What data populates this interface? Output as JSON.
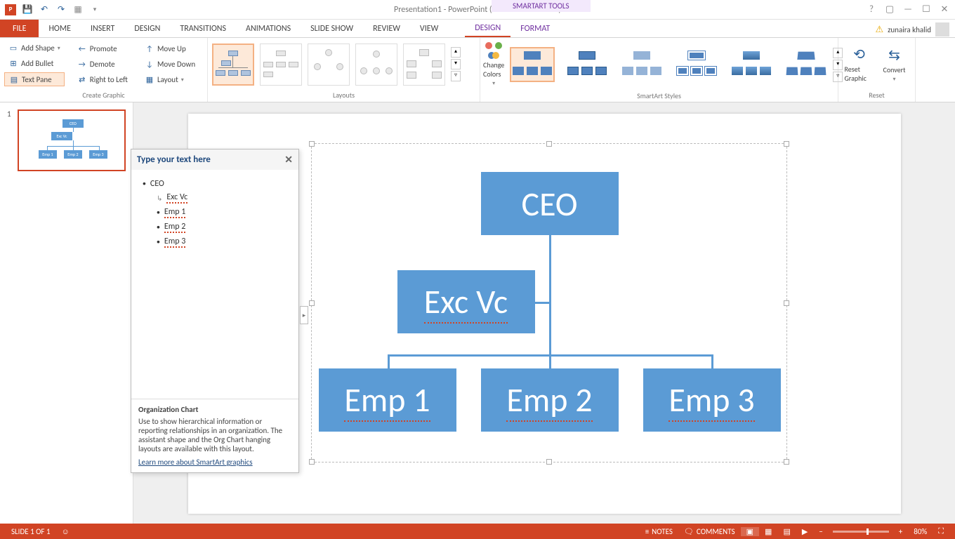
{
  "titlebar": {
    "title": "Presentation1 - PowerPoint (Unlicensed Product)",
    "contextual": "SMARTART TOOLS"
  },
  "user": {
    "name": "zunaira khalid"
  },
  "tabs": {
    "file": "FILE",
    "items": [
      "HOME",
      "INSERT",
      "DESIGN",
      "TRANSITIONS",
      "ANIMATIONS",
      "SLIDE SHOW",
      "REVIEW",
      "VIEW"
    ],
    "context": [
      "DESIGN",
      "FORMAT"
    ],
    "context_active": 0
  },
  "ribbon": {
    "create": {
      "add_shape": "Add Shape",
      "add_bullet": "Add Bullet",
      "text_pane": "Text Pane",
      "promote": "Promote",
      "demote": "Demote",
      "rtl": "Right to Left",
      "move_up": "Move Up",
      "move_down": "Move Down",
      "layout": "Layout",
      "label": "Create Graphic"
    },
    "layouts_label": "Layouts",
    "change_colors": "Change Colors",
    "styles_label": "SmartArt Styles",
    "reset": "Reset Graphic",
    "convert": "Convert",
    "reset_label": "Reset"
  },
  "thumb": {
    "num": "1",
    "boxes": [
      "CEO",
      "Exc Vc",
      "Emp 1",
      "Emp 2",
      "Emp 3"
    ]
  },
  "smartart": {
    "ceo": "CEO",
    "exc": "Exc Vc",
    "e1": "Emp 1",
    "e2": "Emp 2",
    "e3": "Emp 3"
  },
  "textpane": {
    "title": "Type your text here",
    "items": [
      "CEO",
      "Exc Vc",
      "Emp 1",
      "Emp 2",
      "Emp 3"
    ],
    "footer_title": "Organization Chart",
    "footer_body": "Use to show hierarchical information or reporting relationships in an organization. The assistant shape and the Org Chart hanging layouts are available with this layout.",
    "link": "Learn more about SmartArt graphics"
  },
  "status": {
    "slide": "SLIDE 1 OF 1",
    "notes": "NOTES",
    "comments": "COMMENTS",
    "zoom": "80%"
  }
}
